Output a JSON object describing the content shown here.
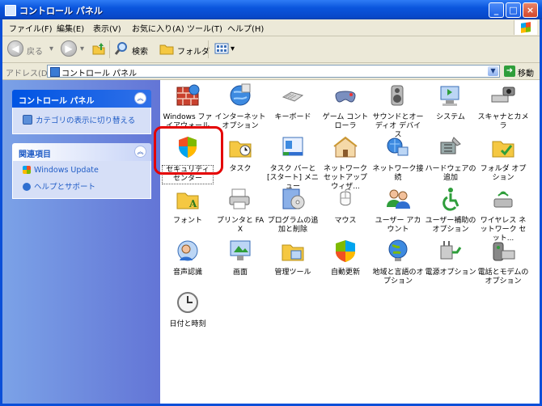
{
  "window": {
    "title": "コントロール パネル"
  },
  "menu": [
    "ファイル(F)",
    "編集(E)",
    "表示(V)",
    "お気に入り(A)",
    "ツール(T)",
    "ヘルプ(H)"
  ],
  "toolbar": {
    "back": "戻る",
    "search": "検索",
    "folders": "フォルダ"
  },
  "address": {
    "label": "アドレス(D)",
    "value": "コントロール パネル",
    "go": "移動"
  },
  "sidebar": {
    "cp_panel": {
      "title": "コントロール パネル",
      "items": [
        "カテゴリの表示に切り替える"
      ]
    },
    "related_panel": {
      "title": "関連項目",
      "items": [
        "Windows Update",
        "ヘルプとサポート"
      ]
    }
  },
  "items": [
    {
      "label": "Windows ファイアウォール",
      "icon": "firewall-icon"
    },
    {
      "label": "インターネット オプション",
      "icon": "internet-options-icon"
    },
    {
      "label": "キーボード",
      "icon": "keyboard-icon"
    },
    {
      "label": "ゲーム コントローラ",
      "icon": "game-controller-icon"
    },
    {
      "label": "サウンドとオーディオ デバイス",
      "icon": "sound-icon"
    },
    {
      "label": "システム",
      "icon": "system-icon"
    },
    {
      "label": "スキャナとカメラ",
      "icon": "scanner-icon"
    },
    {
      "label": "セキュリティ センター",
      "icon": "security-center-icon",
      "selected": true
    },
    {
      "label": "タスク",
      "icon": "scheduled-tasks-icon"
    },
    {
      "label": "タスク バーと [スタート] メニュー",
      "icon": "taskbar-icon"
    },
    {
      "label": "ネットワーク セットアップ ウィザ...",
      "icon": "network-setup-icon"
    },
    {
      "label": "ネットワーク接続",
      "icon": "network-connections-icon"
    },
    {
      "label": "ハードウェアの追加",
      "icon": "add-hardware-icon"
    },
    {
      "label": "フォルダ オプション",
      "icon": "folder-options-icon"
    },
    {
      "label": "フォント",
      "icon": "fonts-icon"
    },
    {
      "label": "プリンタと FAX",
      "icon": "printers-icon"
    },
    {
      "label": "プログラムの追加と削除",
      "icon": "add-remove-programs-icon"
    },
    {
      "label": "マウス",
      "icon": "mouse-icon"
    },
    {
      "label": "ユーザー アカウント",
      "icon": "user-accounts-icon"
    },
    {
      "label": "ユーザー補助のオプション",
      "icon": "accessibility-icon"
    },
    {
      "label": "ワイヤレス ネットワーク セット...",
      "icon": "wireless-icon"
    },
    {
      "label": "音声認識",
      "icon": "speech-icon"
    },
    {
      "label": "画面",
      "icon": "display-icon"
    },
    {
      "label": "管理ツール",
      "icon": "admin-tools-icon"
    },
    {
      "label": "自動更新",
      "icon": "automatic-updates-icon"
    },
    {
      "label": "地域と言語のオプション",
      "icon": "regional-options-icon"
    },
    {
      "label": "電源オプション",
      "icon": "power-options-icon"
    },
    {
      "label": "電話とモデムのオプション",
      "icon": "phone-modem-icon"
    },
    {
      "label": "日付と時刻",
      "icon": "date-time-icon"
    }
  ],
  "colors": {
    "titlebar": "#0a55dd",
    "sidebar": "#7ba2e7",
    "highlight": "#e40000"
  }
}
